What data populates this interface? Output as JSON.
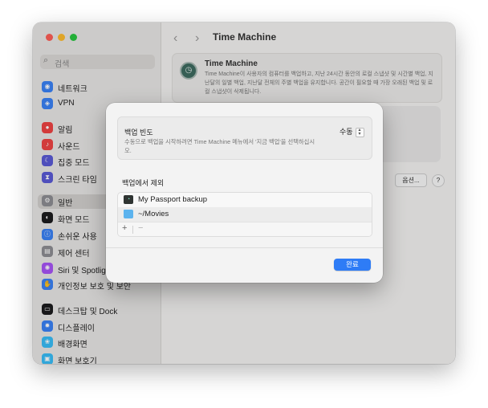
{
  "window": {
    "title": "Time Machine",
    "nav_back": "‹",
    "nav_forward": "›"
  },
  "sidebar": {
    "search_placeholder": "검색",
    "items": [
      {
        "label": "네트워크",
        "icon": "network-icon",
        "color": "#3b82f6"
      },
      {
        "label": "VPN",
        "icon": "vpn-icon",
        "color": "#3b82f6"
      },
      {
        "label": "알림",
        "icon": "notifications-icon",
        "color": "#ef4444"
      },
      {
        "label": "사운드",
        "icon": "sound-icon",
        "color": "#ef4444"
      },
      {
        "label": "집중 모드",
        "icon": "focus-icon",
        "color": "#5b5bd6"
      },
      {
        "label": "스크린 타임",
        "icon": "screen-time-icon",
        "color": "#5b5bd6"
      },
      {
        "label": "일반",
        "icon": "general-icon",
        "color": "#8e8e93",
        "selected": true
      },
      {
        "label": "화면 모드",
        "icon": "appearance-icon",
        "color": "#1c1c1e"
      },
      {
        "label": "손쉬운 사용",
        "icon": "accessibility-icon",
        "color": "#3b82f6"
      },
      {
        "label": "제어 센터",
        "icon": "control-center-icon",
        "color": "#8e8e93"
      },
      {
        "label": "Siri 및 Spotlight",
        "icon": "siri-icon",
        "color": "#a855f7"
      },
      {
        "label": "개인정보 보호 및 보안",
        "icon": "privacy-hand-icon",
        "color": "#3b82f6"
      },
      {
        "label": "데스크탑 및 Dock",
        "icon": "desktop-dock-icon",
        "color": "#1c1c1e"
      },
      {
        "label": "디스플레이",
        "icon": "displays-icon",
        "color": "#3b82f6"
      },
      {
        "label": "배경화면",
        "icon": "wallpaper-icon",
        "color": "#38bdf8"
      },
      {
        "label": "화면 보호기",
        "icon": "screensaver-icon",
        "color": "#38bdf8"
      }
    ]
  },
  "main": {
    "tm_name": "Time Machine",
    "tm_desc": "Time Machine이 사용자의 컴퓨터를 백업하고, 지난 24시간 동안의 로컬 스냅샷 및 시간별 백업, 지난달의 일별 백업, 지난달 전체의 주별 백업을 유지합니다. 공간이 필요할 때 가장 오래된 백업 및 로컬 스냅샷이 삭제됩니다.",
    "options_label": "옵션...",
    "help_label": "?"
  },
  "dialog": {
    "freq_label": "백업 빈도",
    "freq_desc": "수동으로 백업을 시작하려면 Time Machine 메뉴에서 '지금 백업'을 선택하십시오.",
    "freq_value": "수동",
    "exclude_title": "백업에서 제외",
    "exclusions": [
      {
        "label": "My Passport backup",
        "icon": "external-disk-icon"
      },
      {
        "label": "~/Movies",
        "icon": "folder-icon"
      }
    ],
    "add_label": "+",
    "remove_label": "−",
    "done_label": "완료"
  },
  "colors": {
    "accent": "#2e7cf6",
    "folder": "#5cb3ee"
  }
}
